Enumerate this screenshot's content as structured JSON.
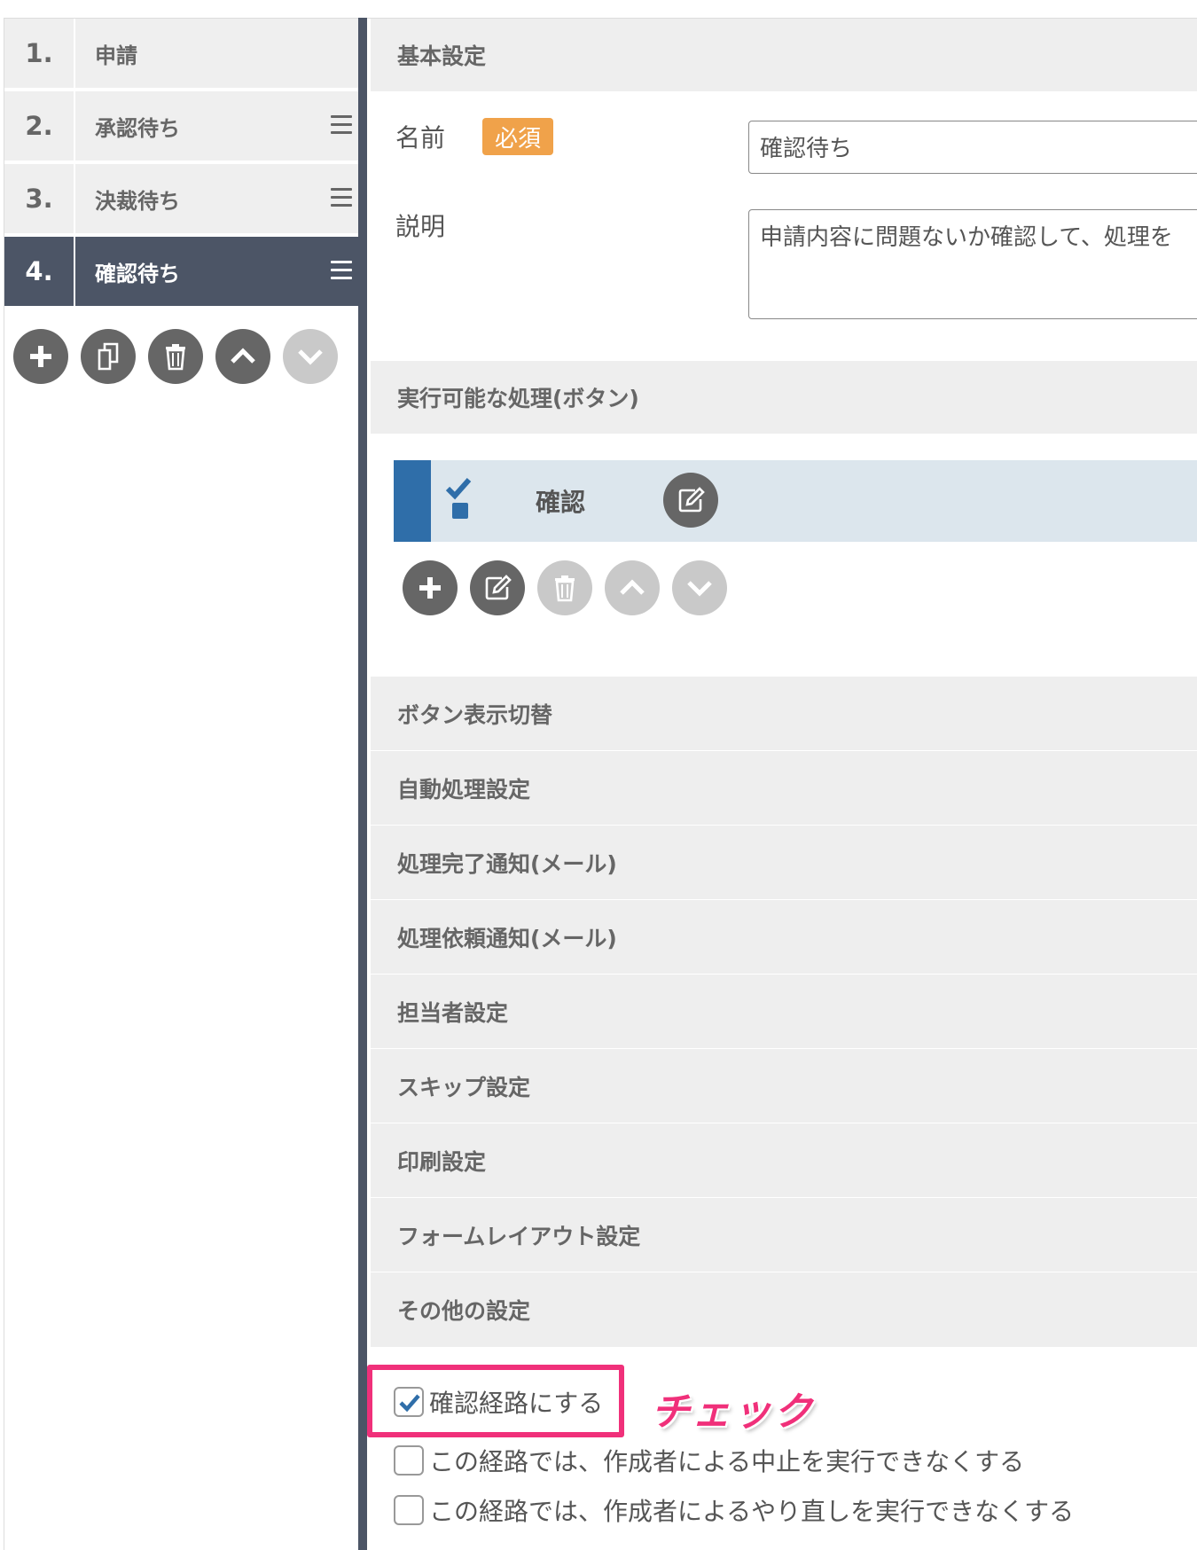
{
  "steps": [
    {
      "num": "1.",
      "label": "申請"
    },
    {
      "num": "2.",
      "label": "承認待ち"
    },
    {
      "num": "3.",
      "label": "決裁待ち"
    },
    {
      "num": "4.",
      "label": "確認待ち"
    }
  ],
  "step_toolbar": [
    "plus-icon",
    "copy-icon",
    "trash-icon",
    "chevron-up-icon",
    "chevron-down-icon"
  ],
  "basic": {
    "section_title": "基本設定",
    "name_label": "名前",
    "required_badge": "必須",
    "name_value": "確認待ち",
    "desc_label": "説明",
    "desc_value": "申請内容に問題ないか確認して、処理を"
  },
  "actions": {
    "section_title": "実行可能な処理(ボタン)",
    "items": [
      {
        "label": "確認",
        "icon": "check-icon"
      }
    ],
    "toolbar": [
      "plus-icon",
      "edit-icon",
      "trash-icon",
      "chevron-up-icon",
      "chevron-down-icon"
    ]
  },
  "sections": [
    "ボタン表示切替",
    "自動処理設定",
    "処理完了通知(メール)",
    "処理依頼通知(メール)",
    "担当者設定",
    "スキップ設定",
    "印刷設定",
    "フォームレイアウト設定",
    "その他の設定"
  ],
  "options": [
    {
      "label": "確認経路にする",
      "checked": true
    },
    {
      "label": "この経路では、作成者による中止を実行できなくする",
      "checked": false
    },
    {
      "label": "この経路では、作成者によるやり直しを実行できなくする",
      "checked": false
    }
  ],
  "annotation": "チェック",
  "colors": {
    "active_step": "#4c5566",
    "required_badge": "#f0a24a",
    "highlight": "#f0307a",
    "action_bar": "#2f6ea9"
  }
}
